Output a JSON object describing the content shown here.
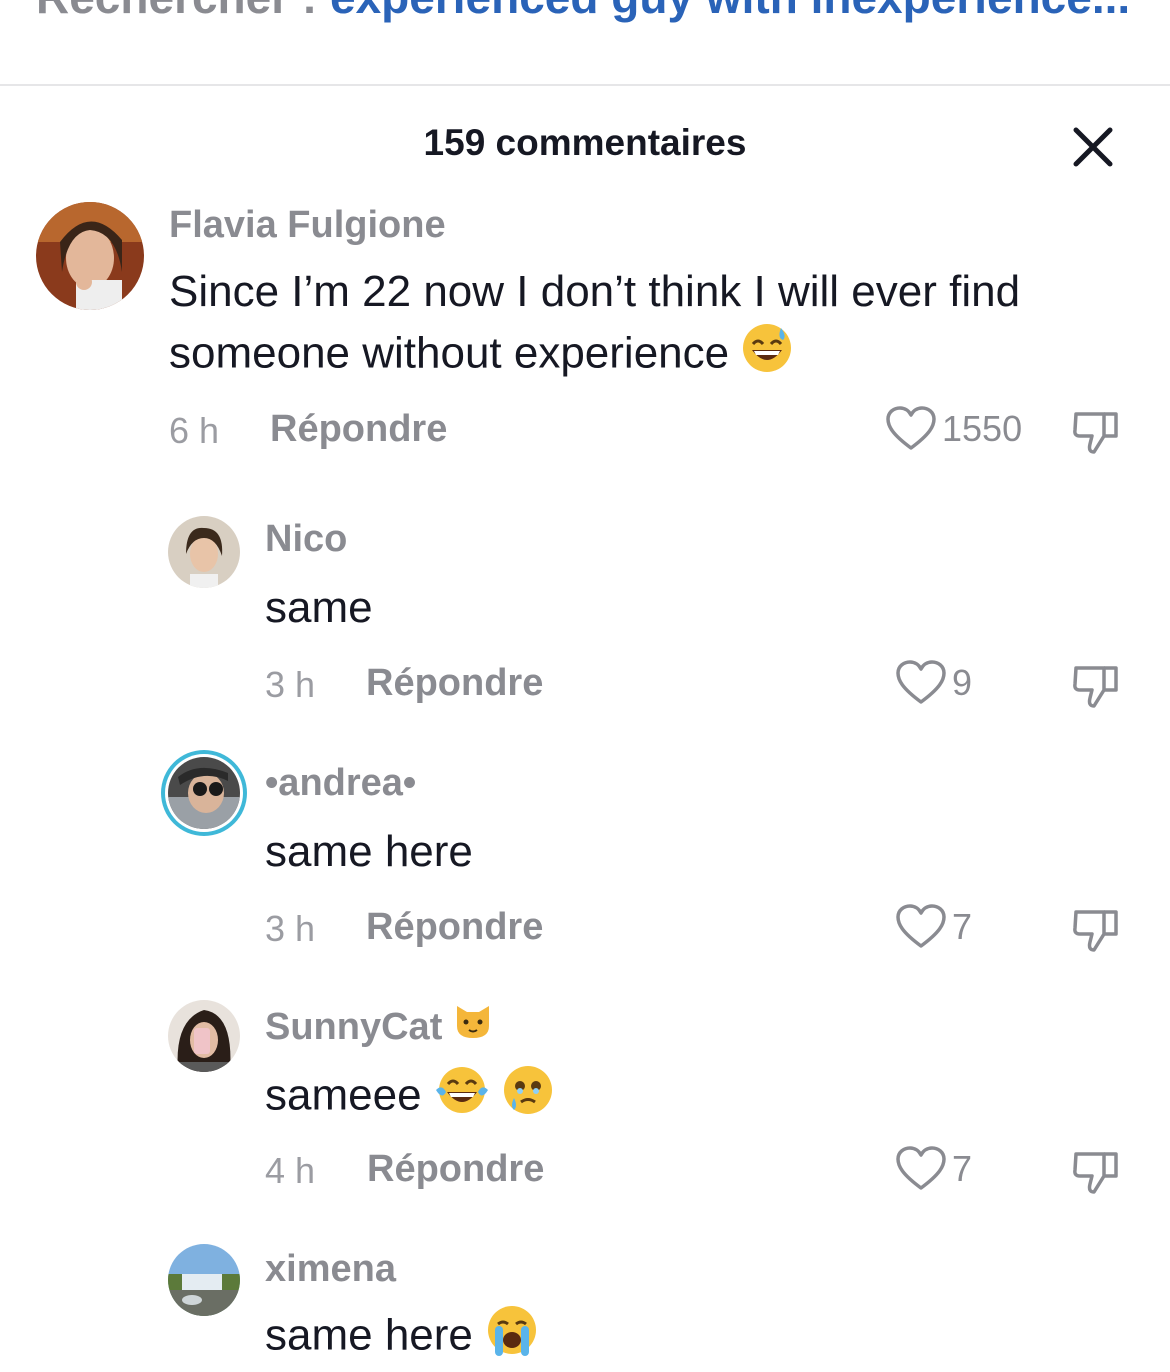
{
  "search": {
    "prefix": "Rechercher : ",
    "query": "experienced guy with inexperience..."
  },
  "panel": {
    "title": "159 commentaires"
  },
  "colors": {
    "accent": "#2a63b8",
    "muted": "#8a8b91",
    "text": "#161823",
    "story_ring": "#3fb8d8"
  },
  "comments": [
    {
      "username": "Flavia Fulgione",
      "text_line1": "Since I’m 22 now I don’t think I will ever find",
      "text_line2": "someone without experience",
      "emoji": "grinning-sweat",
      "time": "6 h",
      "reply_label": "Répondre",
      "likes": "1550"
    },
    {
      "username": "Nico",
      "text": "same",
      "time": "3 h",
      "reply_label": "Répondre",
      "likes": "9"
    },
    {
      "username": "•andrea•",
      "text": "same here",
      "time": "3 h",
      "reply_label": "Répondre",
      "likes": "7",
      "has_story_ring": true
    },
    {
      "username": "SunnyCat",
      "username_emoji": "cat-face",
      "text": "sameee",
      "emojis": [
        "tears-of-joy",
        "holding-back-tears"
      ],
      "time": "4 h",
      "reply_label": "Répondre",
      "likes": "7"
    },
    {
      "username": "ximena",
      "text": "same here",
      "emoji": "loudly-crying",
      "time": "",
      "reply_label": "",
      "likes": ""
    }
  ]
}
